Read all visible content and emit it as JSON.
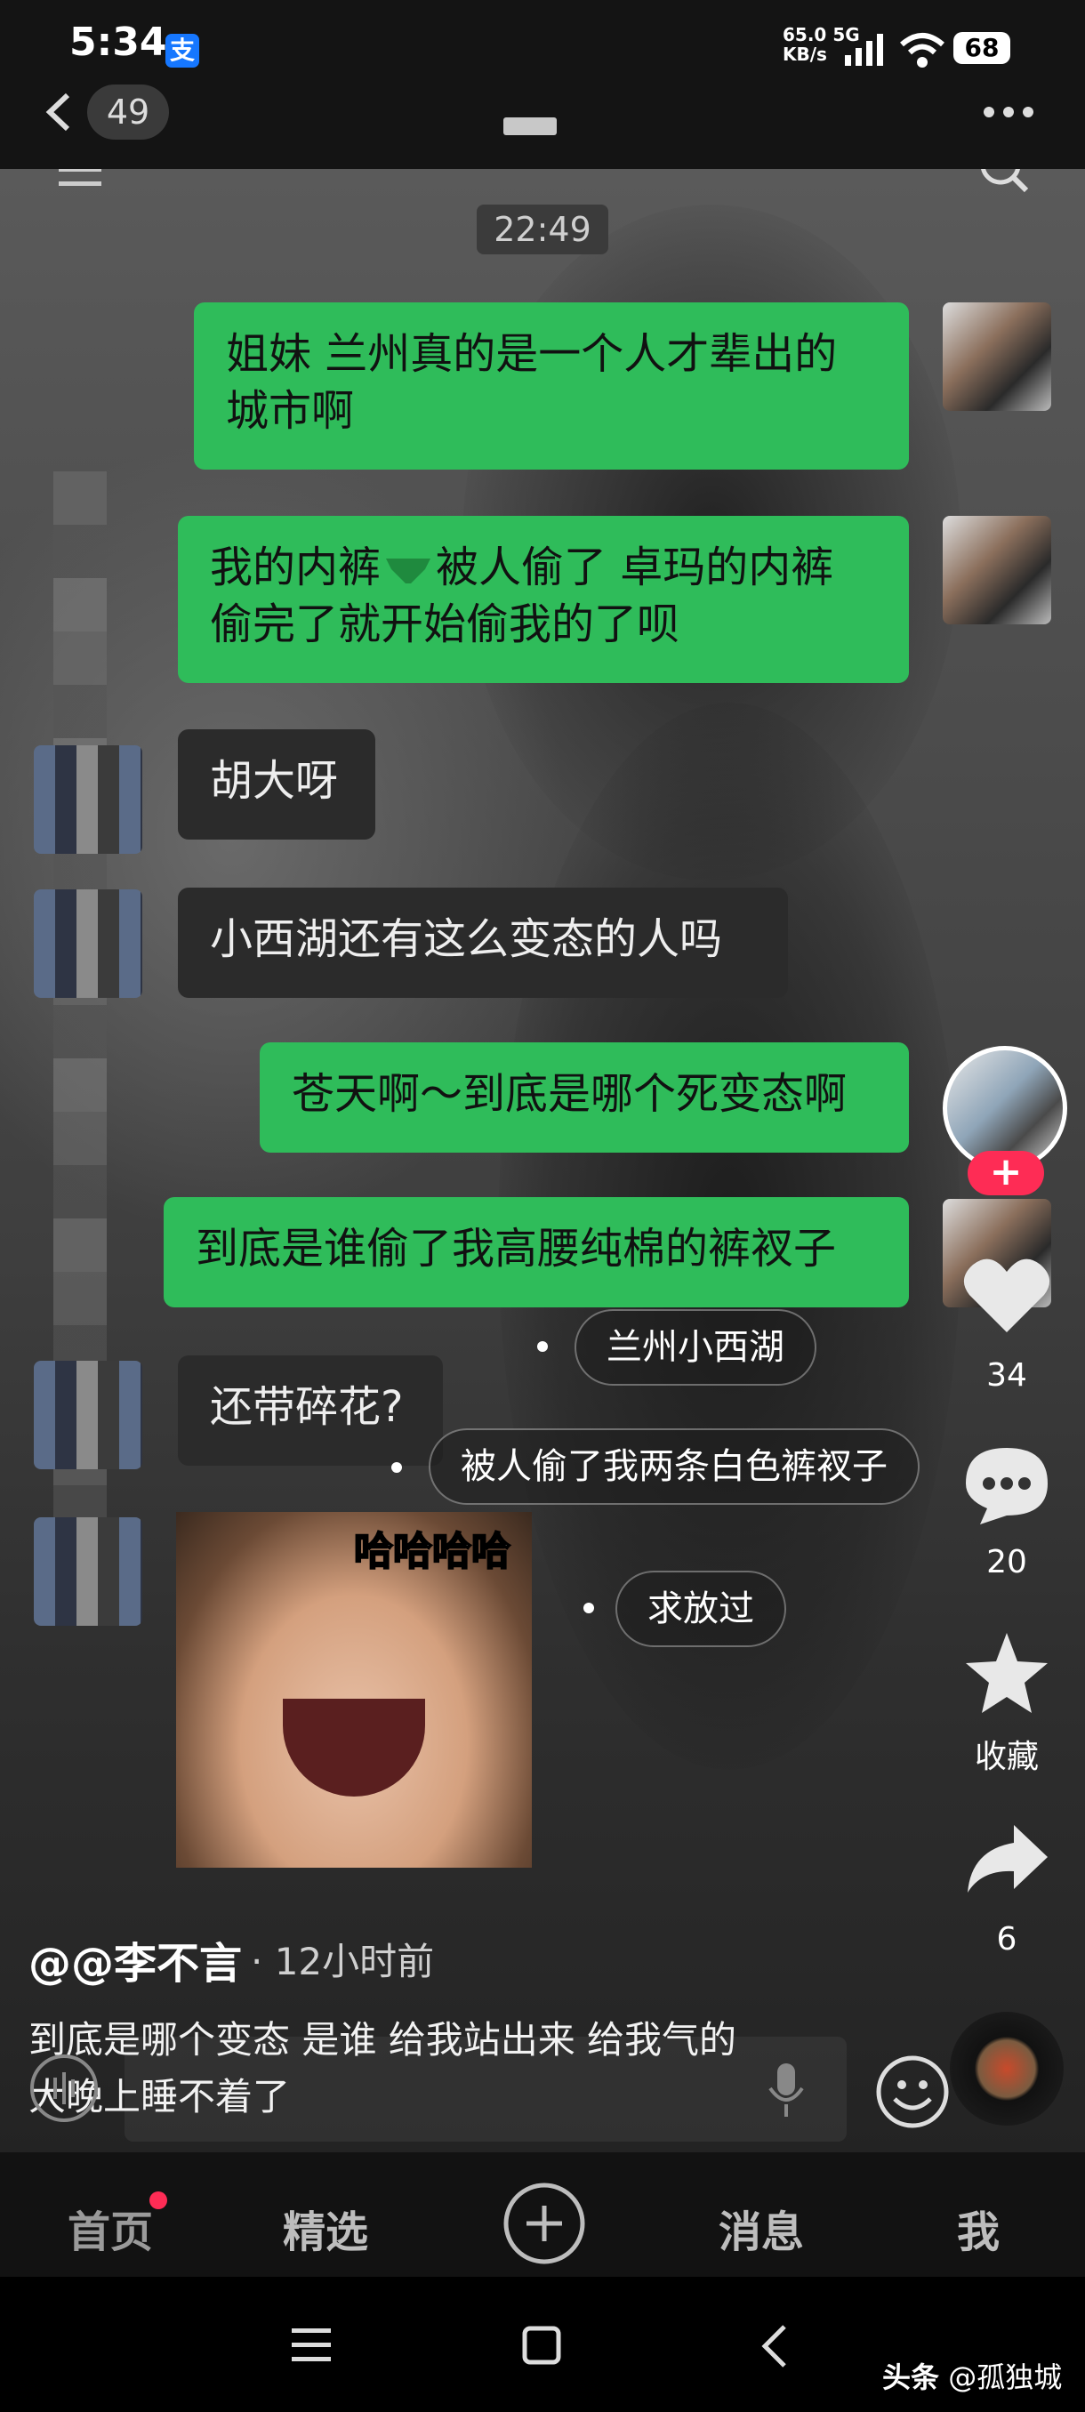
{
  "status_bar": {
    "time": "5:34",
    "app_badge": "支",
    "net_speed_value": "65.0",
    "net_speed_unit": "KB/s",
    "net_type": "5G",
    "battery": "68"
  },
  "top_nav": {
    "back_count": "49"
  },
  "chat": {
    "timestamp": "22:49",
    "messages": [
      {
        "side": "right",
        "line1": "姐妹 兰州真的是一个人才辈出的",
        "line2": "城市啊"
      },
      {
        "side": "right",
        "line1a": "我的内裤",
        "line1b": "被人偷了 卓玛的内裤",
        "line2": "偷完了就开始偷我的了呗"
      },
      {
        "side": "left",
        "text": "胡大呀"
      },
      {
        "side": "left",
        "text": "小西湖还有这么变态的人吗"
      },
      {
        "side": "right",
        "text": "苍天啊～到底是哪个死变态啊"
      },
      {
        "side": "right",
        "text": "到底是谁偷了我高腰纯棉的裤衩子"
      },
      {
        "side": "left",
        "text": "还带碎花?"
      }
    ],
    "meme_caption": "哈哈哈哈"
  },
  "tags": [
    "兰州小西湖",
    "被人偷了我两条白色裤衩子",
    "求放过"
  ],
  "side_actions": {
    "likes": "34",
    "comments": "20",
    "favorite_label": "收藏",
    "shares": "6"
  },
  "post": {
    "author": "@@李不言",
    "time_ago": "· 12小时前",
    "caption_line1": "到底是哪个变态 是谁 给我站出来 给我气的",
    "caption_line2": "大晚上睡不着了"
  },
  "bottom_nav": {
    "items": [
      "首页",
      "精选",
      "消息",
      "我"
    ]
  },
  "watermark": {
    "source": "头条",
    "account": "@孤独城"
  },
  "colors": {
    "green_bubble": "#2fbc5a",
    "dark_bubble": "#2b2b2b",
    "follow_plus": "#fe2c55"
  }
}
